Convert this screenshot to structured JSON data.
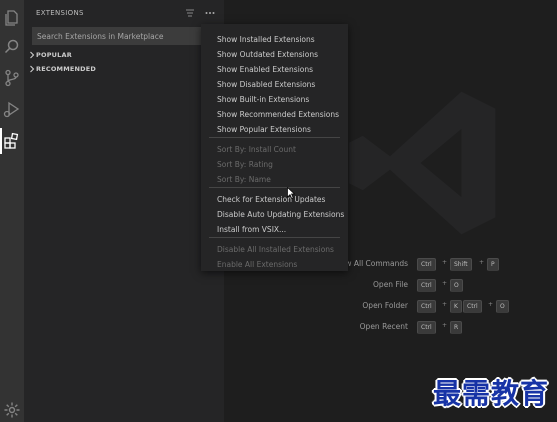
{
  "activity_bar": {
    "icons": [
      "files-icon",
      "search-icon",
      "source-control-icon",
      "run-debug-icon",
      "extensions-icon",
      "settings-gear-icon"
    ]
  },
  "sidebar": {
    "title": "EXTENSIONS",
    "search_placeholder": "Search Extensions in Marketplace",
    "sections": [
      "POPULAR",
      "RECOMMENDED"
    ]
  },
  "menu": {
    "groups": [
      [
        "Show Installed Extensions",
        "Show Outdated Extensions",
        "Show Enabled Extensions",
        "Show Disabled Extensions",
        "Show Built-in Extensions",
        "Show Recommended Extensions",
        "Show Popular Extensions"
      ],
      [
        "Sort By: Install Count",
        "Sort By: Rating",
        "Sort By: Name"
      ],
      [
        "Check for Extension Updates",
        "Disable Auto Updating Extensions",
        "Install from VSIX..."
      ],
      [
        "Disable All Installed Extensions",
        "Enable All Extensions"
      ]
    ],
    "disabled_groups": [
      1,
      3
    ]
  },
  "shortcuts": [
    {
      "label": "w All Commands",
      "keys": [
        "Ctrl",
        "+",
        "Shift",
        "+",
        "P"
      ]
    },
    {
      "label": "Open File",
      "keys": [
        "Ctrl",
        "+",
        "O"
      ]
    },
    {
      "label": "Open Folder",
      "keys": [
        "Ctrl",
        "+",
        "K",
        "Ctrl",
        "+",
        "O"
      ]
    },
    {
      "label": "Open Recent",
      "keys": [
        "Ctrl",
        "+",
        "R"
      ]
    }
  ],
  "brand_text": "最需教育",
  "colors": {
    "activity_bar": "#333333",
    "sidebar": "#252526",
    "editor": "#1e1e1e",
    "brand": "#1733a6"
  }
}
